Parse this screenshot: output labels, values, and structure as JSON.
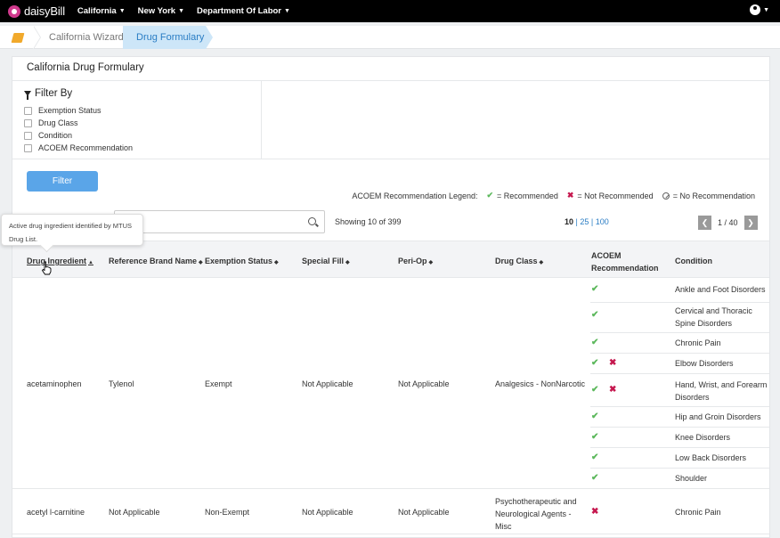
{
  "nav": {
    "logo": "daisyBill",
    "items": [
      "California",
      "New York",
      "Department Of Labor"
    ]
  },
  "breadcrumb": {
    "items": [
      "California Wizard",
      "Drug Formulary"
    ]
  },
  "page": {
    "title": "California Drug Formulary"
  },
  "filter": {
    "title": "Filter By",
    "options": [
      "Exemption Status",
      "Drug Class",
      "Condition",
      "ACOEM Recommendation"
    ],
    "button": "Filter"
  },
  "legend": {
    "label": "ACOEM Recommendation Legend:",
    "recommended": "= Recommended",
    "not_recommended": "= Not Recommended",
    "no_recommendation": "= No Recommendation"
  },
  "listing": {
    "showing": "Showing 10 of 399",
    "page_sizes": [
      "10",
      "| 25",
      "| 100"
    ],
    "page": "1 / 40"
  },
  "tooltip": {
    "text": "Active drug ingredient identified by MTUS Drug List."
  },
  "table": {
    "columns": [
      "Drug Ingredient",
      "Reference Brand Name",
      "Exemption Status",
      "Special Fill",
      "Peri-Op",
      "Drug Class",
      "ACOEM Recommendation",
      "Condition"
    ],
    "rows": [
      {
        "ingredient": "acetaminophen",
        "brand": "Tylenol",
        "exemption": "Exempt",
        "special_fill": "Not Applicable",
        "peri_op": "Not Applicable",
        "drug_class": "Analgesics - NonNarcotic",
        "conditions": [
          {
            "name": "Ankle and Foot Disorders",
            "acoem": [
              "recommended"
            ]
          },
          {
            "name": "Cervical and Thoracic Spine Disorders",
            "acoem": [
              "recommended"
            ]
          },
          {
            "name": "Chronic Pain",
            "acoem": [
              "recommended"
            ]
          },
          {
            "name": "Elbow Disorders",
            "acoem": [
              "recommended",
              "not_recommended"
            ]
          },
          {
            "name": "Hand, Wrist, and Forearm Disorders",
            "acoem": [
              "recommended",
              "not_recommended"
            ]
          },
          {
            "name": "Hip and Groin Disorders",
            "acoem": [
              "recommended"
            ]
          },
          {
            "name": "Knee Disorders",
            "acoem": [
              "recommended"
            ]
          },
          {
            "name": "Low Back Disorders",
            "acoem": [
              "recommended"
            ]
          },
          {
            "name": "Shoulder",
            "acoem": [
              "recommended"
            ]
          }
        ]
      },
      {
        "ingredient": "acetyl l-carnitine",
        "brand": "Not Applicable",
        "exemption": "Non-Exempt",
        "special_fill": "Not Applicable",
        "peri_op": "Not Applicable",
        "drug_class": "Psychotherapeutic and Neurological Agents - Misc",
        "conditions": [
          {
            "name": "Chronic Pain",
            "acoem": [
              "not_recommended"
            ]
          }
        ]
      }
    ]
  },
  "colors": {
    "recommended": "#5cb85c",
    "not_recommended": "#c5174e",
    "primary": "#5aa5e8"
  }
}
